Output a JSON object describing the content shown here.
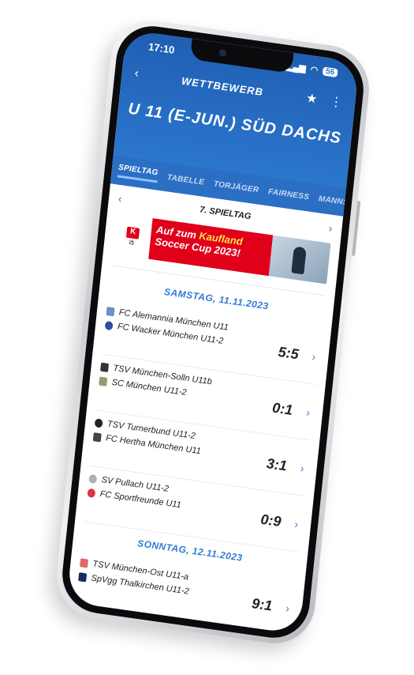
{
  "status": {
    "time": "17:10",
    "battery": "56"
  },
  "nav": {
    "title": "WETTBEWERB",
    "back_icon": "‹",
    "star_icon": "★",
    "more_icon": "⋮"
  },
  "competition": {
    "title": "U 11 (E-JUN.) SÜD DACHS"
  },
  "tabs": [
    {
      "label": "SPIELTAG",
      "active": true
    },
    {
      "label": "TABELLE"
    },
    {
      "label": "TORJÄGER"
    },
    {
      "label": "FAIRNESS"
    },
    {
      "label": "MANNSCHAFTEN"
    }
  ],
  "round": {
    "label": "7. SPIELTAG"
  },
  "banner": {
    "line1_a": "Auf zum ",
    "line1_b": "Kaufland",
    "line2": "Soccer Cup 2023!"
  },
  "days": [
    {
      "date": "SAMSTAG, 11.11.2023",
      "matches": [
        {
          "home": "FC Alemannia München U11",
          "away": "FC Wacker München U11-2",
          "score": "5:5"
        },
        {
          "home": "TSV München-Solln U11b",
          "away": "SC München U11-2",
          "score": "0:1"
        },
        {
          "home": "TSV Turnerbund U11-2",
          "away": "FC Hertha München U11",
          "score": "3:1"
        },
        {
          "home": "SV Pullach U11-2",
          "away": "FC Sportfreunde U11",
          "score": "0:9"
        }
      ]
    },
    {
      "date": "SONNTAG, 12.11.2023",
      "matches": [
        {
          "home": "TSV München-Ost U11-a",
          "away": "SpVgg Thalkirchen U11-2",
          "score": "9:1"
        }
      ]
    }
  ],
  "colors": {
    "primary": "#2f7bd4",
    "header": "#1f5fb3",
    "banner_red": "#e1001a"
  }
}
